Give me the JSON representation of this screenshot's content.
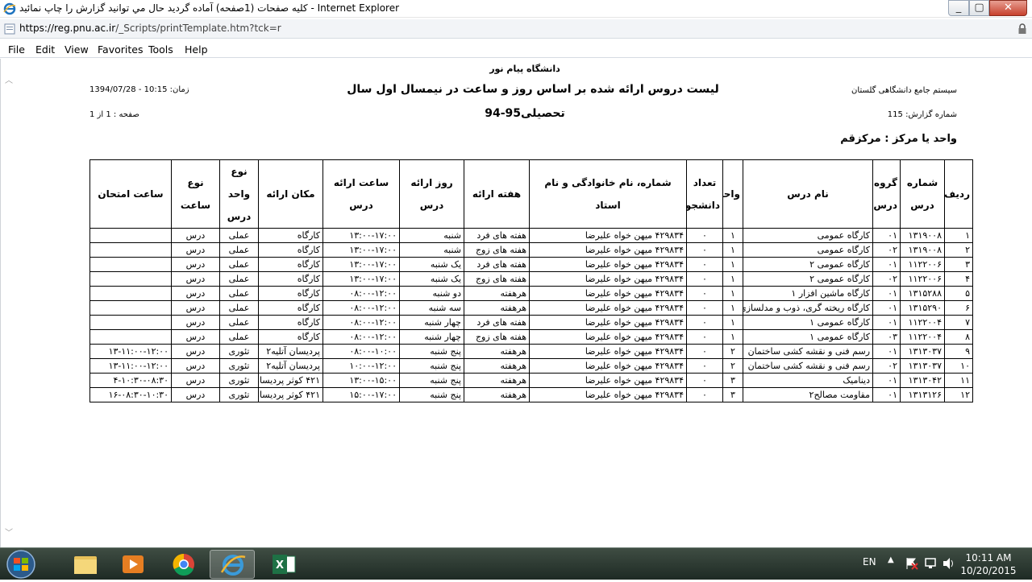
{
  "window": {
    "title": "كليه صفحات (1صفحه) آماده گرديد حال مي توانيد گزارش را چاپ نمائيد - Internet Explorer",
    "minimize": "_",
    "maximize": "▢",
    "close": "✕"
  },
  "address": {
    "domain": "https://reg.pnu.ac.ir",
    "path": "/_Scripts/printTemplate.htm?tck=r"
  },
  "menu": [
    "File",
    "Edit",
    "View",
    "Favorites",
    "Tools",
    "Help"
  ],
  "report": {
    "university": "دانشگاه پیام نور",
    "system": "سیستم جامع دانشگاهی گلستان",
    "title": "لیست دروس ارائه شده بر اساس روز و ساعت در نیمسال اول سال",
    "subtitle": "تحصیلی95-94",
    "time": "زمان: 10:15 - 1394/07/28",
    "report_no": "شماره گزارش: 115",
    "page": "صفحه : 1 از 1",
    "unit": "واحد یا مرکز : مرکزقم",
    "headers": [
      "ردیف",
      "شماره درس",
      "گروه درس",
      "نام درس",
      "واحد",
      "تعداد دانشجو",
      "شماره، نام خانوادگی و نام استاد",
      "هفته ارائه",
      "روز ارائه درس",
      "ساعت ارائه درس",
      "مکان ارائه",
      "نوع واحد درس",
      "نوع ساعت",
      "ساعت امتحان"
    ],
    "rows": [
      [
        "۱",
        "۱۳۱۹۰۰۸",
        "۰۱",
        "کارگاه عمومی",
        "۱",
        "۰",
        "۴۲۹۸۳۴   میهن خواه علیرضا",
        "هفته های فرد",
        "شنبه",
        "۱۳:۰۰-۱۷:۰۰",
        "کارگاه",
        "عملی",
        "درس",
        ""
      ],
      [
        "۲",
        "۱۳۱۹۰۰۸",
        "۰۲",
        "کارگاه عمومی",
        "۱",
        "۰",
        "۴۲۹۸۳۴   میهن خواه علیرضا",
        "هفته های زوج",
        "شنبه",
        "۱۳:۰۰-۱۷:۰۰",
        "کارگاه",
        "عملی",
        "درس",
        ""
      ],
      [
        "۳",
        "۱۱۲۲۰۰۶",
        "۰۱",
        "کارگاه عمومی ۲",
        "۱",
        "۰",
        "۴۲۹۸۳۴   میهن خواه علیرضا",
        "هفته های فرد",
        "یک شنبه",
        "۱۳:۰۰-۱۷:۰۰",
        "کارگاه",
        "عملی",
        "درس",
        ""
      ],
      [
        "۴",
        "۱۱۲۲۰۰۶",
        "۰۲",
        "کارگاه عمومی ۲",
        "۱",
        "۰",
        "۴۲۹۸۳۴   میهن خواه علیرضا",
        "هفته های زوج",
        "یک شنبه",
        "۱۳:۰۰-۱۷:۰۰",
        "کارگاه",
        "عملی",
        "درس",
        ""
      ],
      [
        "۵",
        "۱۳۱۵۲۸۸",
        "۰۱",
        "کارگاه ماشین افزار ۱",
        "۱",
        "۰",
        "۴۲۹۸۳۴   میهن خواه علیرضا",
        "هرهفته",
        "دو شنبه",
        "۰۸:۰۰-۱۲:۰۰",
        "کارگاه",
        "عملی",
        "درس",
        ""
      ],
      [
        "۶",
        "۱۳۱۵۲۹۰",
        "۰۱",
        "کارگاه ریخته گری، ذوب و مدلسازی",
        "۱",
        "۰",
        "۴۲۹۸۳۴   میهن خواه علیرضا",
        "هرهفته",
        "سه شنبه",
        "۰۸:۰۰-۱۲:۰۰",
        "کارگاه",
        "عملی",
        "درس",
        ""
      ],
      [
        "۷",
        "۱۱۲۲۰۰۴",
        "۰۱",
        "کارگاه عمومی ۱",
        "۱",
        "۰",
        "۴۲۹۸۳۴   میهن خواه علیرضا",
        "هفته های فرد",
        "چهار شنبه",
        "۰۸:۰۰-۱۲:۰۰",
        "کارگاه",
        "عملی",
        "درس",
        ""
      ],
      [
        "۸",
        "۱۱۲۲۰۰۴",
        "۰۳",
        "کارگاه عمومی ۱",
        "۱",
        "۰",
        "۴۲۹۸۳۴   میهن خواه علیرضا",
        "هفته های زوج",
        "چهار شنبه",
        "۰۸:۰۰-۱۲:۰۰",
        "کارگاه",
        "عملی",
        "درس",
        ""
      ],
      [
        "۹",
        "۱۳۱۳۰۳۷",
        "۰۱",
        "رسم فنی و نقشه کشی ساختمان",
        "۲",
        "۰",
        "۴۲۹۸۳۴   میهن خواه علیرضا",
        "هرهفته",
        "پنج شنبه",
        "۰۸:۰۰-۱۰:۰۰",
        "پردیسان آتلیه۲",
        "تئوری",
        "درس",
        "۱۳-۱۱:۰۰-۱۲:۰۰"
      ],
      [
        "۱۰",
        "۱۳۱۳۰۳۷",
        "۰۲",
        "رسم فنی و نقشه کشی ساختمان",
        "۲",
        "۰",
        "۴۲۹۸۳۴   میهن خواه علیرضا",
        "هرهفته",
        "پنج شنبه",
        "۱۰:۰۰-۱۲:۰۰",
        "پردیسان آتلیه۲",
        "تئوری",
        "درس",
        "۱۳-۱۱:۰۰-۱۲:۰۰"
      ],
      [
        "۱۱",
        "۱۳۱۳۰۴۲",
        "۰۱",
        "دینامیک",
        "۳",
        "۰",
        "۴۲۹۸۳۴   میهن خواه علیرضا",
        "هرهفته",
        "پنج شنبه",
        "۱۳:۰۰-۱۵:۰۰",
        "۴۲۱ کوثر پردیسان",
        "تئوری",
        "درس",
        "۴-۱۰:۳۰-۰۸:۳۰"
      ],
      [
        "۱۲",
        "۱۳۱۳۱۲۶",
        "۰۱",
        "مقاومت مصالح۲",
        "۳",
        "۰",
        "۴۲۹۸۳۴   میهن خواه علیرضا",
        "هرهفته",
        "پنج شنبه",
        "۱۵:۰۰-۱۷:۰۰",
        "۴۲۱ کوثر پردیسان",
        "تئوری",
        "درس",
        "۱۶-۰۸:۳۰-۱۰:۳۰"
      ]
    ]
  },
  "taskbar": {
    "lang": "EN",
    "time": "10:11 AM",
    "date": "10/20/2015",
    "icons": [
      "windows-start-icon",
      "file-explorer-icon",
      "media-player-icon",
      "chrome-icon",
      "internet-explorer-icon",
      "excel-icon"
    ]
  }
}
